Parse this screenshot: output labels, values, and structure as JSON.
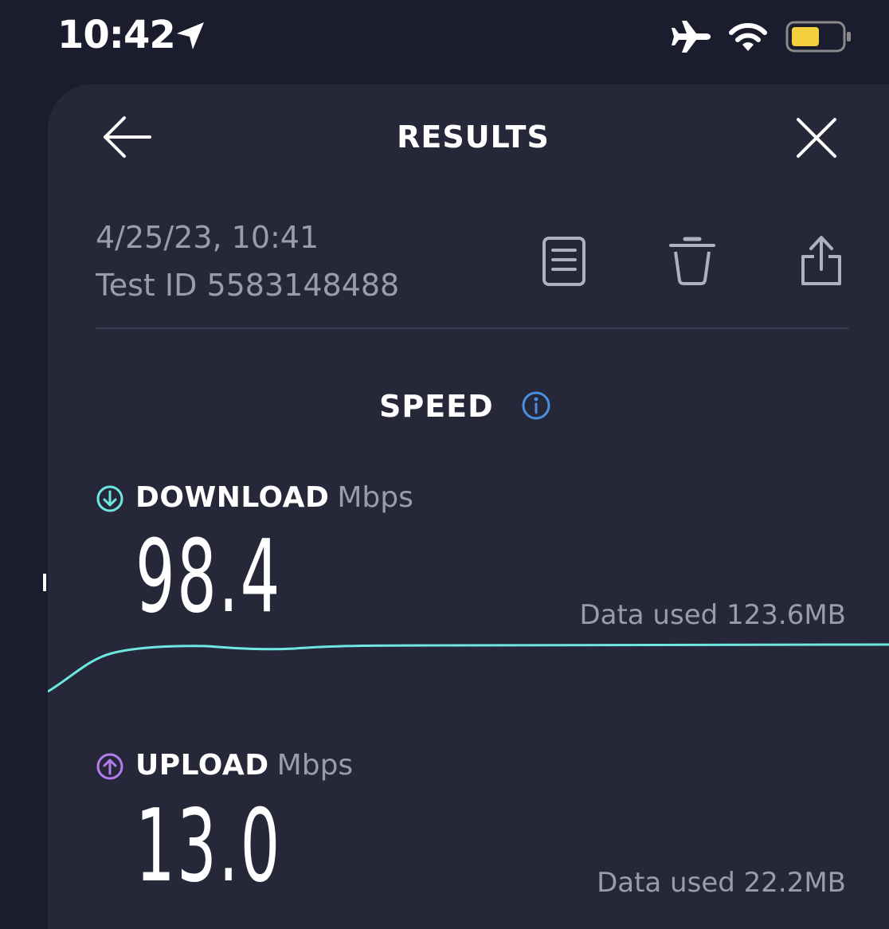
{
  "status_bar": {
    "time": "10:42",
    "icons": [
      "location-arrow-icon",
      "airplane-icon",
      "wifi-icon",
      "battery-icon"
    ],
    "battery_color": "#f4d03f"
  },
  "header": {
    "title": "RESULTS",
    "icons": [
      "back-arrow-icon",
      "close-icon"
    ]
  },
  "meta": {
    "date": "4/25/23, 10:41",
    "test_id": "Test ID 5583148488",
    "actions": [
      "document-icon",
      "trash-icon",
      "share-icon"
    ]
  },
  "speed": {
    "title": "SPEED",
    "info_icon": "info-icon",
    "info_color": "#4a90e2",
    "download": {
      "label": "DOWNLOAD",
      "unit": "Mbps",
      "value": "98.4",
      "data_used": "Data used 123.6MB",
      "color": "#6ee7e0"
    },
    "upload": {
      "label": "UPLOAD",
      "unit": "Mbps",
      "value": "13.0",
      "data_used": "Data used 22.2MB",
      "color": "#b57cf0"
    }
  }
}
